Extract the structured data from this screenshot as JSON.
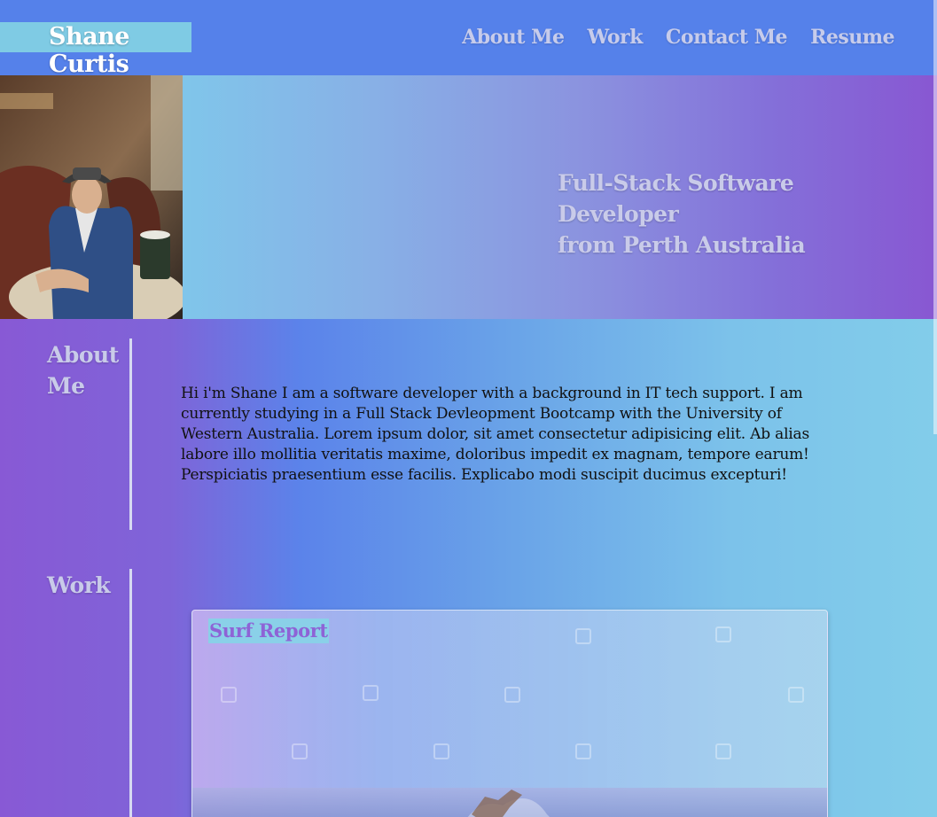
{
  "header": {
    "brand": "Shane Curtis",
    "nav": [
      "About Me",
      "Work",
      "Contact Me",
      "Resume"
    ]
  },
  "hero": {
    "tagline_line1": "Full-Stack Software Developer",
    "tagline_line2": "from Perth Australia"
  },
  "about": {
    "title_line1": "About",
    "title_line2": "Me",
    "text": "Hi i'm Shane I am a software developer with a background in IT tech support. I am currently studying in a Full Stack Devleopment Bootcamp with the University of Western Australia. Lorem ipsum dolor, sit amet consectetur adipisicing elit. Ab alias labore illo mollitia veritatis maxime, doloribus impedit ex magnam, tempore earum! Perspiciatis praesentium esse facilis. Explicabo modi suscipit ducimus excepturi!"
  },
  "work": {
    "title": "Work",
    "projects": [
      {
        "title": "Surf Report"
      }
    ]
  },
  "colors": {
    "header_bg": "#5581ea",
    "brand_bg": "#7fcbe4",
    "heading_text": "#c9cbe9",
    "card_title_text": "#8e63d6"
  }
}
